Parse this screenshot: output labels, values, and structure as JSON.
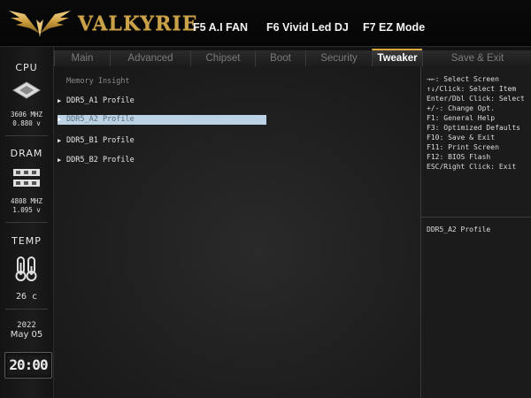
{
  "header": {
    "brand": "VALKYRIE",
    "fkeys": [
      "F5 A.I FAN",
      "F6 Vivid Led DJ",
      "F7 EZ Mode"
    ]
  },
  "sidebar": {
    "cpu": {
      "label": "CPU",
      "freq": "3606 MHZ",
      "volt": "0.880 v"
    },
    "dram": {
      "label": "DRAM",
      "freq": "4808 MHZ",
      "volt": "1.095 v"
    },
    "temp": {
      "label": "TEMP",
      "value": "26 c"
    },
    "date": {
      "year": "2022",
      "day": "May 05"
    },
    "clock": "20:00"
  },
  "tabs": [
    {
      "label": "Main",
      "active": false
    },
    {
      "label": "Advanced",
      "active": false
    },
    {
      "label": "Chipset",
      "active": false
    },
    {
      "label": "Boot",
      "active": false
    },
    {
      "label": "Security",
      "active": false
    },
    {
      "label": "Tweaker",
      "active": true
    },
    {
      "label": "Save & Exit",
      "active": false
    }
  ],
  "main": {
    "section_title": "Memory Insight",
    "items": [
      {
        "label": "DDR5_A1 Profile",
        "selected": false
      },
      {
        "label": "DDR5_A2 Profile",
        "selected": true
      },
      {
        "label": "DDR5_B1 Profile",
        "selected": false
      },
      {
        "label": "DDR5_B2 Profile",
        "selected": false
      }
    ]
  },
  "help": {
    "keys": [
      "→←: Select Screen",
      "↑↓/Click: Select Item",
      "Enter/Dbl Click: Select",
      "+/-: Change Opt.",
      "F1: General Help",
      "F3: Optimized Defaults",
      "F10: Save & Exit",
      "F11: Print Screen",
      "F12: BIOS Flash",
      "ESC/Right Click: Exit"
    ],
    "description": "DDR5_A2 Profile"
  },
  "colors": {
    "accent": "#d8a83a",
    "brand": "#c9a24a",
    "selection": "#bcd3e6"
  }
}
